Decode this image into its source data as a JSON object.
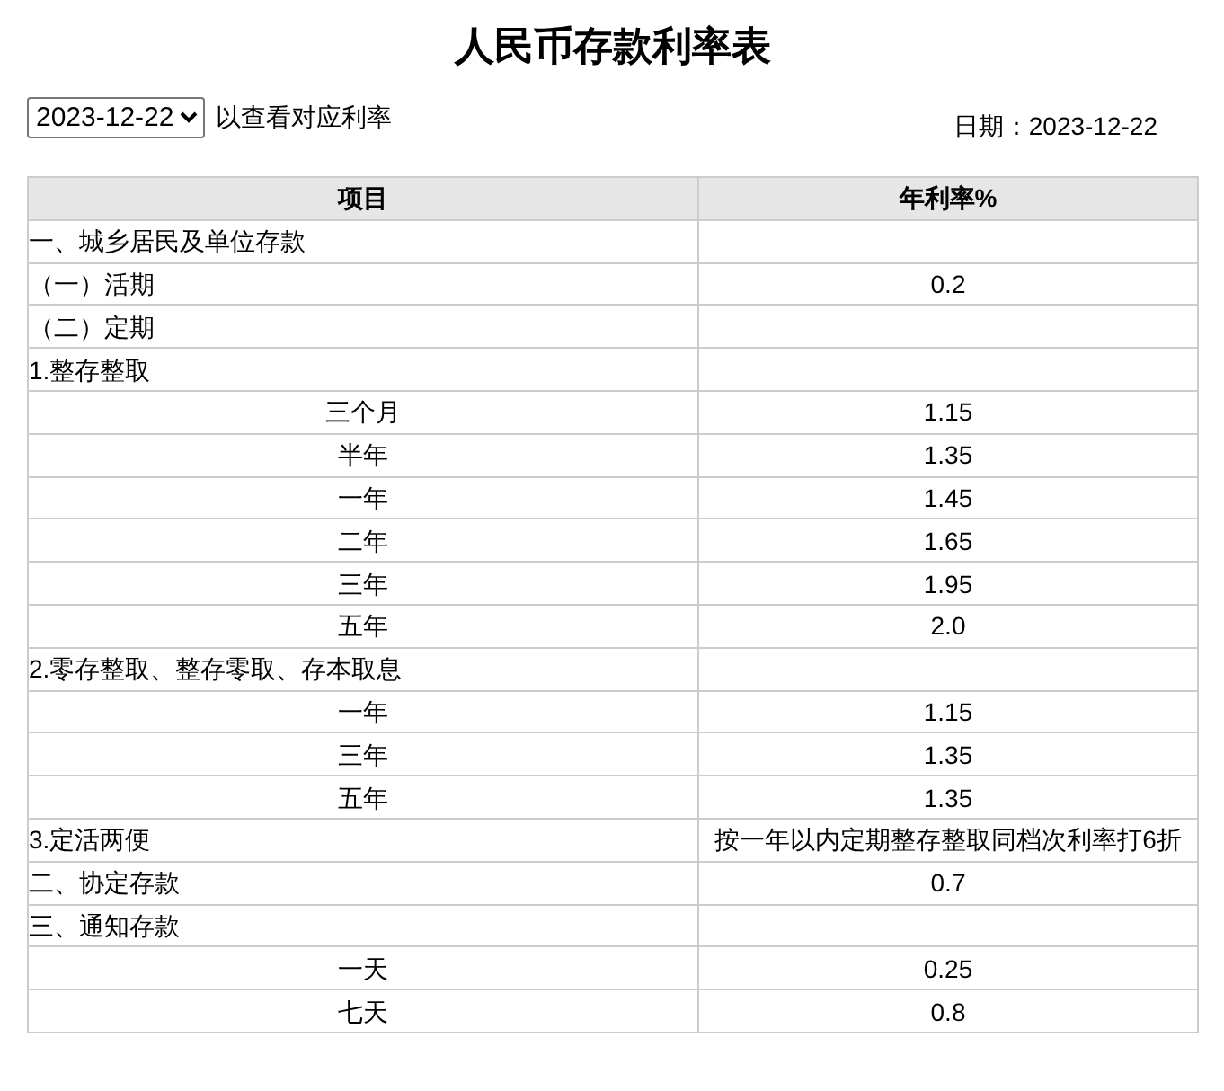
{
  "title": "人民币存款利率表",
  "date_select": {
    "value": "2023-12-22"
  },
  "select_hint": "以查看对应利率",
  "date_label": "日期：2023-12-22",
  "table": {
    "columns": [
      "项目",
      "年利率%"
    ],
    "rows": [
      {
        "kind": "group",
        "item": "一、城乡居民及单位存款",
        "rate": ""
      },
      {
        "kind": "group",
        "item": "（一）活期",
        "rate": "0.2"
      },
      {
        "kind": "group",
        "item": "（二）定期",
        "rate": ""
      },
      {
        "kind": "group",
        "item": "1.整存整取",
        "rate": ""
      },
      {
        "kind": "term",
        "item": "三个月",
        "rate": "1.15"
      },
      {
        "kind": "term",
        "item": "半年",
        "rate": "1.35"
      },
      {
        "kind": "term",
        "item": "一年",
        "rate": "1.45"
      },
      {
        "kind": "term",
        "item": "二年",
        "rate": "1.65"
      },
      {
        "kind": "term",
        "item": "三年",
        "rate": "1.95"
      },
      {
        "kind": "term",
        "item": "五年",
        "rate": "2.0"
      },
      {
        "kind": "group",
        "item": "2.零存整取、整存零取、存本取息",
        "rate": ""
      },
      {
        "kind": "term",
        "item": "一年",
        "rate": "1.15"
      },
      {
        "kind": "term",
        "item": "三年",
        "rate": "1.35"
      },
      {
        "kind": "term",
        "item": "五年",
        "rate": "1.35"
      },
      {
        "kind": "group",
        "item": "3.定活两便",
        "rate": "按一年以内定期整存整取同档次利率打6折"
      },
      {
        "kind": "group",
        "item": "二、协定存款",
        "rate": "0.7"
      },
      {
        "kind": "group",
        "item": "三、通知存款",
        "rate": ""
      },
      {
        "kind": "term",
        "item": "一天",
        "rate": "0.25"
      },
      {
        "kind": "term",
        "item": "七天",
        "rate": "0.8"
      }
    ]
  }
}
